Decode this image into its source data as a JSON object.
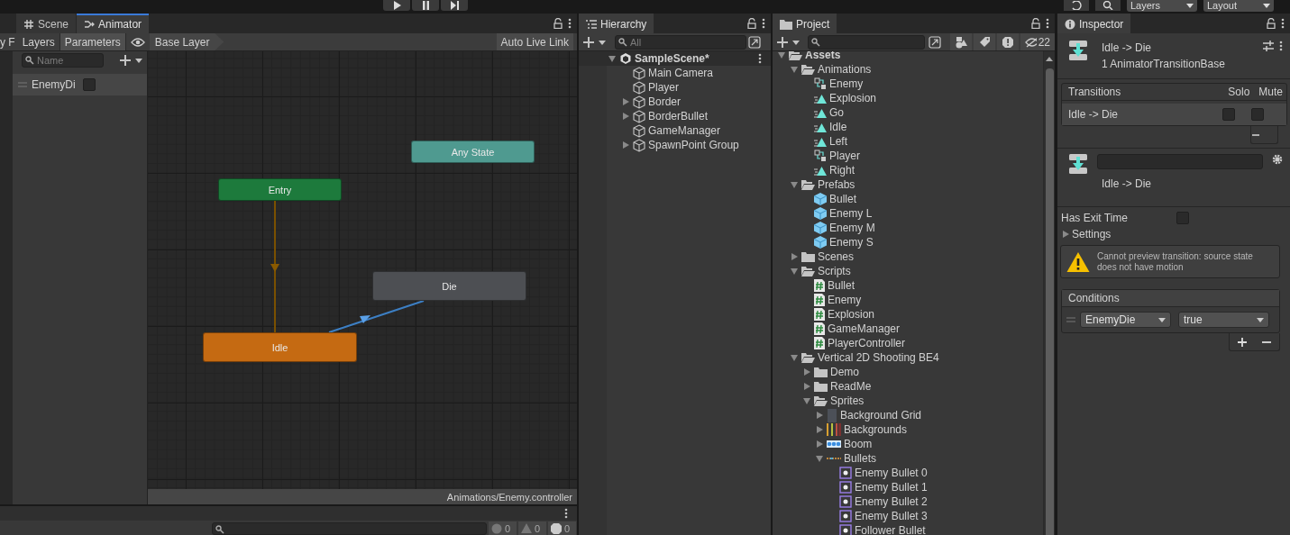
{
  "toolbar": {
    "layers_label": "Layers",
    "layout_label": "Layout"
  },
  "animator": {
    "focused": true,
    "cut_tab": "y F",
    "tabs": [
      {
        "label": "Scene",
        "selected": false
      },
      {
        "label": "Animator",
        "selected": true
      }
    ],
    "mode_tabs": [
      {
        "label": "Layers",
        "selected": false
      },
      {
        "label": "Parameters",
        "selected": true
      }
    ],
    "breadcrumb": "Base Layer",
    "live_link": "Auto Live Link",
    "search": {
      "placeholder": "Name"
    },
    "parameters": [
      {
        "name": "EnemyDi",
        "checked": false
      }
    ],
    "states": [
      {
        "name": "Any State",
        "kind": "any"
      },
      {
        "name": "Entry",
        "kind": "entry"
      },
      {
        "name": "Die",
        "kind": "normal"
      },
      {
        "name": "Idle",
        "kind": "default"
      }
    ],
    "path": "Animations/Enemy.controller"
  },
  "console": {
    "counts": [
      "0",
      "0",
      "0"
    ]
  },
  "hierarchy": {
    "title": "Hierarchy",
    "focused": false,
    "search": {
      "placeholder": "All"
    },
    "scene": "SampleScene*",
    "objects": [
      {
        "name": "Main Camera",
        "kind": "leaf"
      },
      {
        "name": "Player",
        "kind": "leaf"
      },
      {
        "name": "Border",
        "kind": "collapsed"
      },
      {
        "name": "BorderBullet",
        "kind": "collapsed"
      },
      {
        "name": "GameManager",
        "kind": "leaf"
      },
      {
        "name": "SpawnPoint Group",
        "kind": "collapsed"
      }
    ]
  },
  "project": {
    "title": "Project",
    "focused": false,
    "hidden_count": "22",
    "tree": [
      {
        "name": "Assets",
        "kind": "folder",
        "expanded": true,
        "children": [
          {
            "name": "Animations",
            "kind": "folder",
            "expanded": true,
            "children": [
              {
                "name": "Enemy",
                "kind": "controller"
              },
              {
                "name": "Explosion",
                "kind": "clip"
              },
              {
                "name": "Go",
                "kind": "clip"
              },
              {
                "name": "Idle",
                "kind": "clip"
              },
              {
                "name": "Left",
                "kind": "clip"
              },
              {
                "name": "Player",
                "kind": "controller"
              },
              {
                "name": "Right",
                "kind": "clip"
              }
            ]
          },
          {
            "name": "Prefabs",
            "kind": "folder",
            "expanded": true,
            "children": [
              {
                "name": "Bullet",
                "kind": "prefab"
              },
              {
                "name": "Enemy L",
                "kind": "prefab"
              },
              {
                "name": "Enemy M",
                "kind": "prefab"
              },
              {
                "name": "Enemy S",
                "kind": "prefab"
              }
            ]
          },
          {
            "name": "Scenes",
            "kind": "folder",
            "expanded": false
          },
          {
            "name": "Scripts",
            "kind": "folder",
            "expanded": true,
            "children": [
              {
                "name": "Bullet",
                "kind": "script"
              },
              {
                "name": "Enemy",
                "kind": "script"
              },
              {
                "name": "Explosion",
                "kind": "script"
              },
              {
                "name": "GameManager",
                "kind": "script"
              },
              {
                "name": "PlayerController",
                "kind": "script"
              }
            ]
          },
          {
            "name": "Vertical 2D Shooting BE4",
            "kind": "folder",
            "expanded": true,
            "children": [
              {
                "name": "Demo",
                "kind": "folder",
                "expanded": false
              },
              {
                "name": "ReadMe",
                "kind": "folder",
                "expanded": false
              },
              {
                "name": "Sprites",
                "kind": "folder",
                "expanded": true,
                "children": [
                  {
                    "name": "Background Grid",
                    "kind": "tile",
                    "expanded": false
                  },
                  {
                    "name": "Backgrounds",
                    "kind": "strips",
                    "expanded": false
                  },
                  {
                    "name": "Boom",
                    "kind": "sheet",
                    "expanded": false
                  },
                  {
                    "name": "Bullets",
                    "kind": "dashes",
                    "expanded": true,
                    "children": [
                      {
                        "name": "Enemy Bullet 0",
                        "kind": "sprite"
                      },
                      {
                        "name": "Enemy Bullet 1",
                        "kind": "sprite"
                      },
                      {
                        "name": "Enemy Bullet 2",
                        "kind": "sprite"
                      },
                      {
                        "name": "Enemy Bullet 3",
                        "kind": "sprite"
                      },
                      {
                        "name": "Follower Bullet",
                        "kind": "sprite"
                      }
                    ]
                  }
                ]
              }
            ]
          }
        ]
      }
    ]
  },
  "inspector": {
    "title": "Inspector",
    "focused": false,
    "header": {
      "name": "Idle -> Die",
      "subtitle": "1 AnimatorTransitionBase"
    },
    "transitions": {
      "title": "Transitions",
      "solo_label": "Solo",
      "mute_label": "Mute",
      "rows": [
        {
          "name": "Idle -> Die",
          "selected": true,
          "solo": false,
          "mute": false
        }
      ]
    },
    "transition_label": "Idle -> Die",
    "has_exit_time": {
      "label": "Has Exit Time",
      "checked": false
    },
    "settings": {
      "label": "Settings",
      "expanded": false
    },
    "warning": "Cannot preview transition: source state does not have motion",
    "conditions": {
      "title": "Conditions",
      "rows": [
        {
          "parameter": "EnemyDie",
          "value": "true"
        }
      ]
    }
  }
}
